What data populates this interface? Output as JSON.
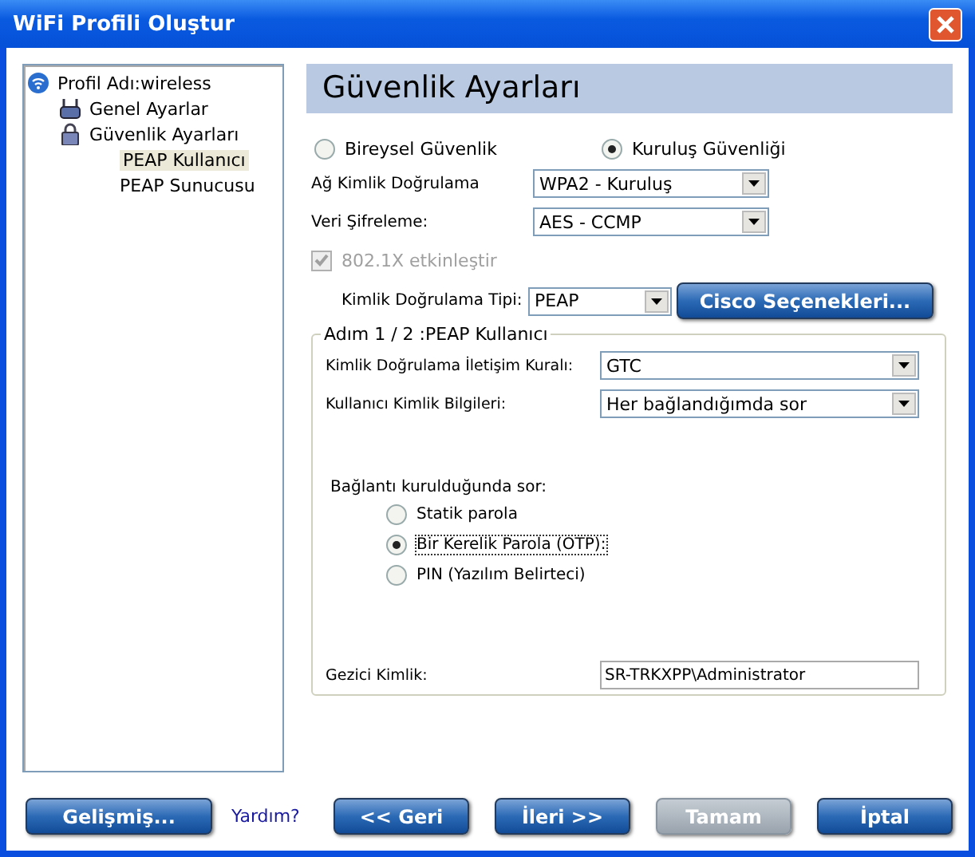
{
  "window": {
    "title": "WiFi Profili Oluştur"
  },
  "tree": {
    "label": "Profil Adı:wireless",
    "kind": "wifi",
    "children": [
      {
        "label": "Genel Ayarlar",
        "kind": "router",
        "selected": false
      },
      {
        "label": "Güvenlik Ayarları",
        "kind": "lock",
        "selected": false,
        "children": [
          {
            "label": "PEAP Kullanıcı",
            "selected": true
          },
          {
            "label": "PEAP Sunucusu",
            "selected": false
          }
        ]
      }
    ]
  },
  "heading": "Güvenlik Ayarları",
  "security_modes": [
    {
      "label": "Bireysel Güvenlik",
      "selected": false
    },
    {
      "label": "Kuruluş Güvenliği",
      "selected": true
    }
  ],
  "fields": [
    {
      "label": "Ağ Kimlik Doğrulama",
      "value": "WPA2 - Kuruluş"
    },
    {
      "label": "Veri Şifreleme:",
      "value": "AES - CCMP"
    }
  ],
  "enable_8021x": {
    "label": "802.1X etkinleştir",
    "checked": true,
    "disabled": true
  },
  "auth_type": {
    "label": "Kimlik Doğrulama Tipi:",
    "value": "PEAP"
  },
  "cisco_button": "Cisco Seçenekleri...",
  "group": {
    "title": "Adım 1 / 2 :PEAP Kullanıcı",
    "fields": [
      {
        "label": "Kimlik Doğrulama İletişim Kuralı:",
        "value": "GTC"
      },
      {
        "label": "Kullanıcı Kimlik Bilgileri:",
        "value": "Her bağlandığımda sor"
      }
    ],
    "prompt_label": "Bağlantı kurulduğunda sor:",
    "prompt_options": [
      {
        "label": "Statik parola",
        "selected": false,
        "focused": false
      },
      {
        "label": "Bir Kerelik Parola (OTP):",
        "selected": true,
        "focused": true
      },
      {
        "label": "PIN (Yazılım Belirteci)",
        "selected": false,
        "focused": false
      }
    ],
    "roaming": {
      "label": "Gezici Kimlik:",
      "value": "SR-TRKXPP\\Administrator"
    }
  },
  "advanced_button": {
    "label": "Gelişmiş...",
    "disabled": false
  },
  "help_link": "Yardım?",
  "buttons": [
    {
      "label": "<< Geri",
      "disabled": false
    },
    {
      "label": "İleri >>",
      "disabled": false
    },
    {
      "label": "Tamam",
      "disabled": true
    },
    {
      "label": "İptal",
      "disabled": false
    }
  ]
}
